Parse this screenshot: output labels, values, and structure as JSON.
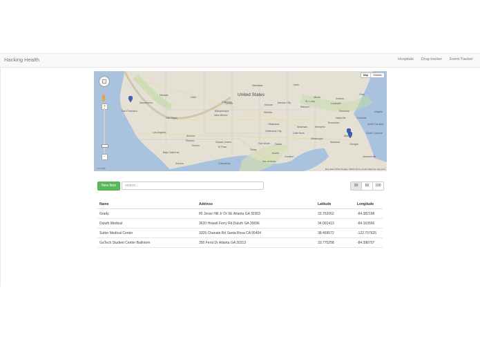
{
  "navbar": {
    "brand": "Hacking Health",
    "links": [
      "Hospitals",
      "Drug tracker",
      "Event Tracker"
    ]
  },
  "map": {
    "map_type": [
      "Map",
      "Satellite"
    ],
    "country_label": "United States",
    "labels": [
      "Nevada",
      "Utah",
      "Colorado",
      "Kansas",
      "Missouri",
      "Illinois",
      "Indiana",
      "Ohio",
      "Kentucky",
      "Virginia",
      "Tennessee",
      "North Carolina",
      "South Carolina",
      "Oklahoma",
      "Arkansas",
      "Mississippi",
      "Alabama",
      "Georgia",
      "Texas",
      "New Mexico",
      "Arizona",
      "Los Angeles",
      "San Francisco",
      "Sacramento",
      "Las Vegas",
      "Phoenix",
      "Tucson",
      "Albuquerque",
      "Dallas",
      "Fort Worth",
      "Houston",
      "San Antonio",
      "Austin",
      "Memphis",
      "Atlanta",
      "Jacksonville",
      "Nebraska",
      "Iowa",
      "Denver",
      "Sonora",
      "Chihuahua",
      "Baja California",
      "Ciudad Juarez",
      "El Paso",
      "Nashville",
      "Louisville",
      "St. Louis",
      "Kansas City",
      "Wichita",
      "Oklahoma City",
      "Little Rock",
      "Charlotte"
    ],
    "attribution": "Map data ©2014 Google, INEGI  Terms of Use  Report a map error",
    "google_logo": "Google"
  },
  "toolbar": {
    "new_item": "New Item",
    "search_placeholder": "search...",
    "page_sizes": [
      "20",
      "50",
      "100"
    ],
    "active_page_size": "20"
  },
  "table": {
    "headers": [
      "Name",
      "Address",
      "Latitude",
      "Longitude"
    ],
    "rows": [
      [
        "Grady",
        "80 Jesse Hill Jr Dr SE Atlanta GA 30303",
        "33.752062",
        "-84.382198"
      ],
      [
        "Duluth Medical",
        "3620 Howell Ferry Rd Duluth GA 30096",
        "34.001413",
        "-84.163566"
      ],
      [
        "Sutter Medical Center",
        "3325 Chanate Rd Santa Rosa CA 95404",
        "38.469572",
        "-122.707625"
      ],
      [
        "GaTech Student Center Ballroom",
        "350 Ferst Dr Atlanta GA 30313",
        "33.775258",
        "-84.398707"
      ]
    ]
  },
  "colors": {
    "accent": "#5cb85c",
    "marker": "#3a5fb5",
    "water": "#a5bfdd"
  }
}
